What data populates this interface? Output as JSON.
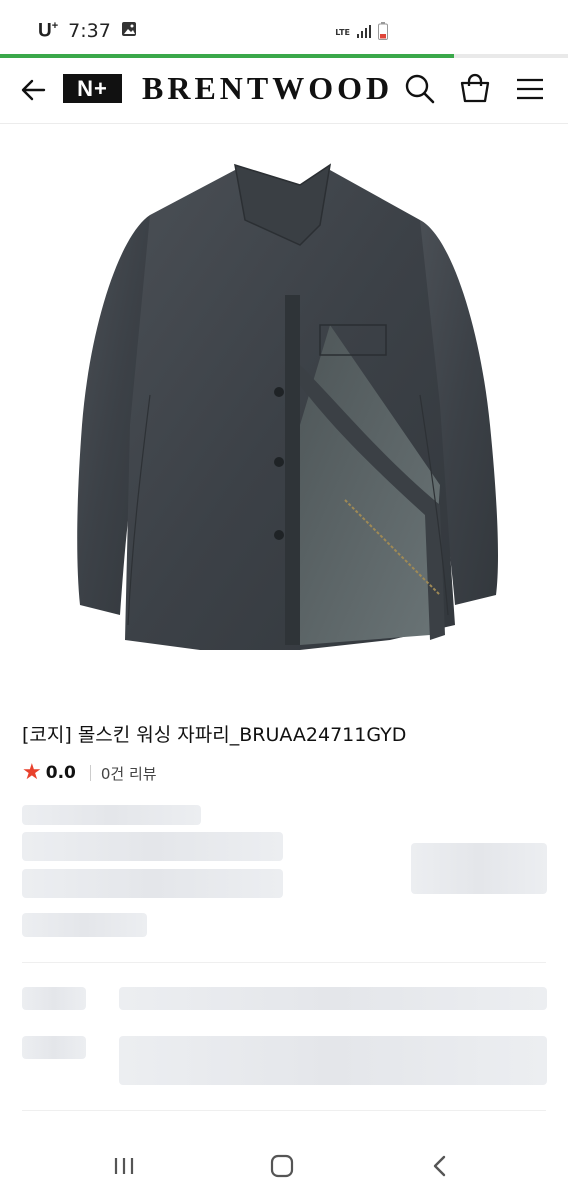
{
  "status": {
    "carrier": "U",
    "carrier_sup": "+",
    "time": "7:37",
    "network": "LTE",
    "page_load_progress": 0.8
  },
  "header": {
    "logo_text": "N+",
    "brand_name": "BRENTWOOD",
    "icons": [
      "arrow-left-icon",
      "search-icon",
      "shopping-bag-icon",
      "hamburger-menu-icon"
    ]
  },
  "product": {
    "image_icon": "jacket-photo",
    "title": "[코지] 몰스킨 워싱 자파리_BRUAA24711GYD",
    "rating": "0.0",
    "review_text": "0건 리뷰",
    "star_color": "#e8412c"
  },
  "nav": {
    "icons": [
      "recent-apps-icon",
      "home-icon",
      "back-icon"
    ]
  },
  "colors": {
    "accent_progress": "#3aa84a",
    "skeleton": "#eceef1"
  }
}
